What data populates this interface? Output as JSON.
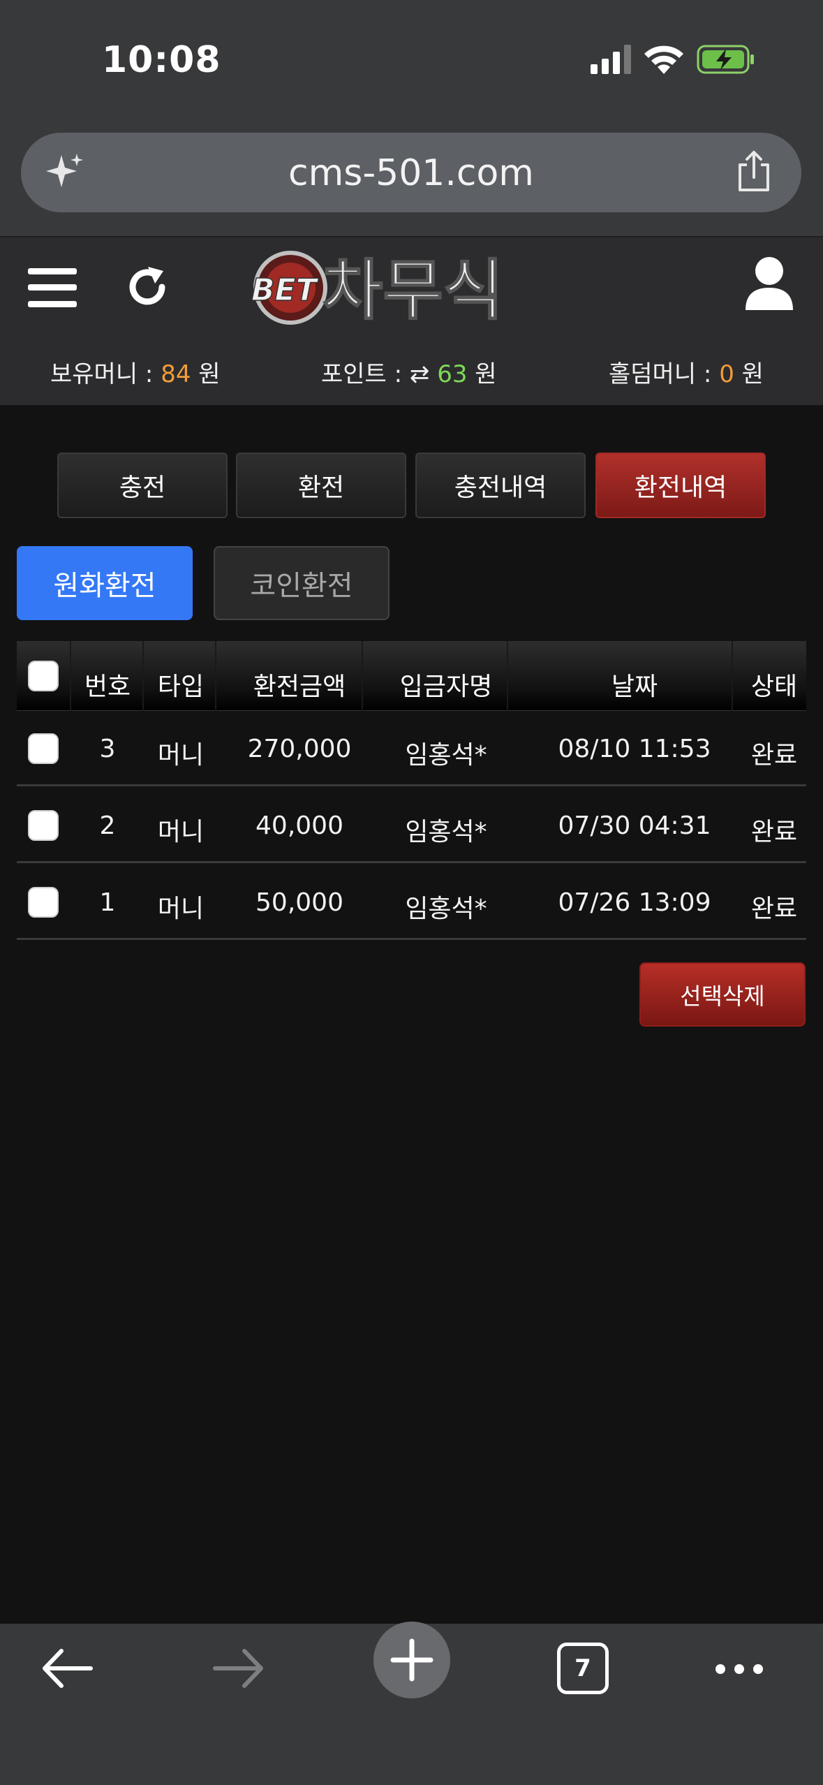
{
  "status": {
    "time": "10:08"
  },
  "browser": {
    "url": "cms-501.com",
    "tab_count": "7"
  },
  "site": {
    "logo_text": "BET 차무식",
    "balances": {
      "money_label": "보유머니 : ",
      "money_value": "84",
      "point_label": "포인트 : ",
      "point_value": "63",
      "holding_label": "홀덤머니 : ",
      "holding_value": "0",
      "unit": " 원"
    }
  },
  "tabs": [
    "충전",
    "환전",
    "충전내역",
    "환전내역"
  ],
  "subtabs": [
    "원화환전",
    "코인환전"
  ],
  "table": {
    "headers": [
      "번호",
      "타입",
      "환전금액",
      "입금자명",
      "날짜",
      "상태"
    ],
    "rows": [
      {
        "no": "3",
        "type": "머니",
        "amount": "270,000",
        "name": "임홍석*",
        "date": "08/10 11:53",
        "status": "완료"
      },
      {
        "no": "2",
        "type": "머니",
        "amount": "40,000",
        "name": "임홍석*",
        "date": "07/30 04:31",
        "status": "완료"
      },
      {
        "no": "1",
        "type": "머니",
        "amount": "50,000",
        "name": "임홍석*",
        "date": "07/26 13:09",
        "status": "완료"
      }
    ]
  },
  "delete_button": "선택삭제",
  "colors": {
    "accent_blue": "#3478f6",
    "accent_red": "#9e2420",
    "orange": "#f29c38",
    "green": "#7ed957"
  }
}
